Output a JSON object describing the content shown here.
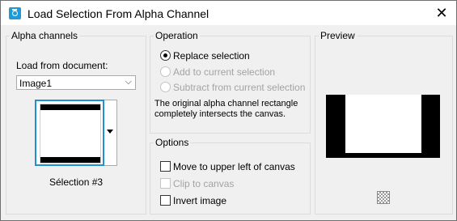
{
  "window": {
    "title": "Load Selection From Alpha Channel",
    "close_glyph": "✕"
  },
  "alpha_channels": {
    "legend": "Alpha channels",
    "load_from_label": "Load from document:",
    "document_value": "Image1",
    "thumbnail_caption": "Sélection #3"
  },
  "operation": {
    "legend": "Operation",
    "options": [
      {
        "label": "Replace selection",
        "selected": true,
        "enabled": true
      },
      {
        "label": "Add to current selection",
        "selected": false,
        "enabled": false
      },
      {
        "label": "Subtract from current selection",
        "selected": false,
        "enabled": false
      }
    ],
    "description": "The original alpha channel rectangle completely intersects the canvas."
  },
  "options": {
    "legend": "Options",
    "items": [
      {
        "label": "Move to upper left of canvas",
        "checked": false,
        "enabled": true
      },
      {
        "label": "Clip to canvas",
        "checked": false,
        "enabled": false
      },
      {
        "label": "Invert image",
        "checked": false,
        "enabled": true
      }
    ]
  },
  "preview": {
    "legend": "Preview"
  },
  "colors": {
    "accent": "#1e90d6",
    "disabled_text": "#a3a3a3",
    "dialog_bg": "#f0f0f0"
  }
}
